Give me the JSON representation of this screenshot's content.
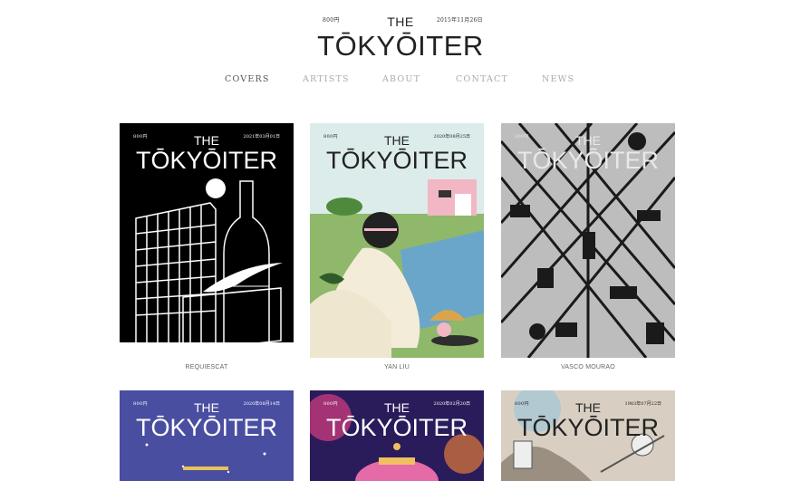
{
  "masthead": {
    "price": "800円",
    "date": "2015年11月26日",
    "the": "THE",
    "name": "TŌKYŌITER"
  },
  "nav": [
    {
      "label": "COVERS",
      "active": true
    },
    {
      "label": "ARTISTS",
      "active": false
    },
    {
      "label": "ABOUT",
      "active": false
    },
    {
      "label": "CONTACT",
      "active": false
    },
    {
      "label": "NEWS",
      "active": false
    }
  ],
  "covers": [
    {
      "price": "800円",
      "date": "2021年03月01日",
      "the": "THE",
      "name": "TŌKYŌITER",
      "artist": "REQUIESCAT"
    },
    {
      "price": "800円",
      "date": "2020年08月25日",
      "the": "THE",
      "name": "TŌKYŌITER",
      "artist": "YAN LIU"
    },
    {
      "price": "800円",
      "date": "",
      "the": "THE",
      "name": "TŌKYŌITER",
      "artist": "VASCO MOURAO"
    },
    {
      "price": "800円",
      "date": "2020年08月14日",
      "the": "THE",
      "name": "TŌKYŌITER",
      "artist": ""
    },
    {
      "price": "800円",
      "date": "2020年02月20日",
      "the": "THE",
      "name": "TŌKYŌITER",
      "artist": ""
    },
    {
      "price": "800円",
      "date": "1983年07月22日",
      "the": "THE",
      "name": "TŌKYŌITER",
      "artist": ""
    }
  ],
  "colors": {
    "nav_active": "#555555",
    "nav_inactive": "#aaaaaa"
  }
}
